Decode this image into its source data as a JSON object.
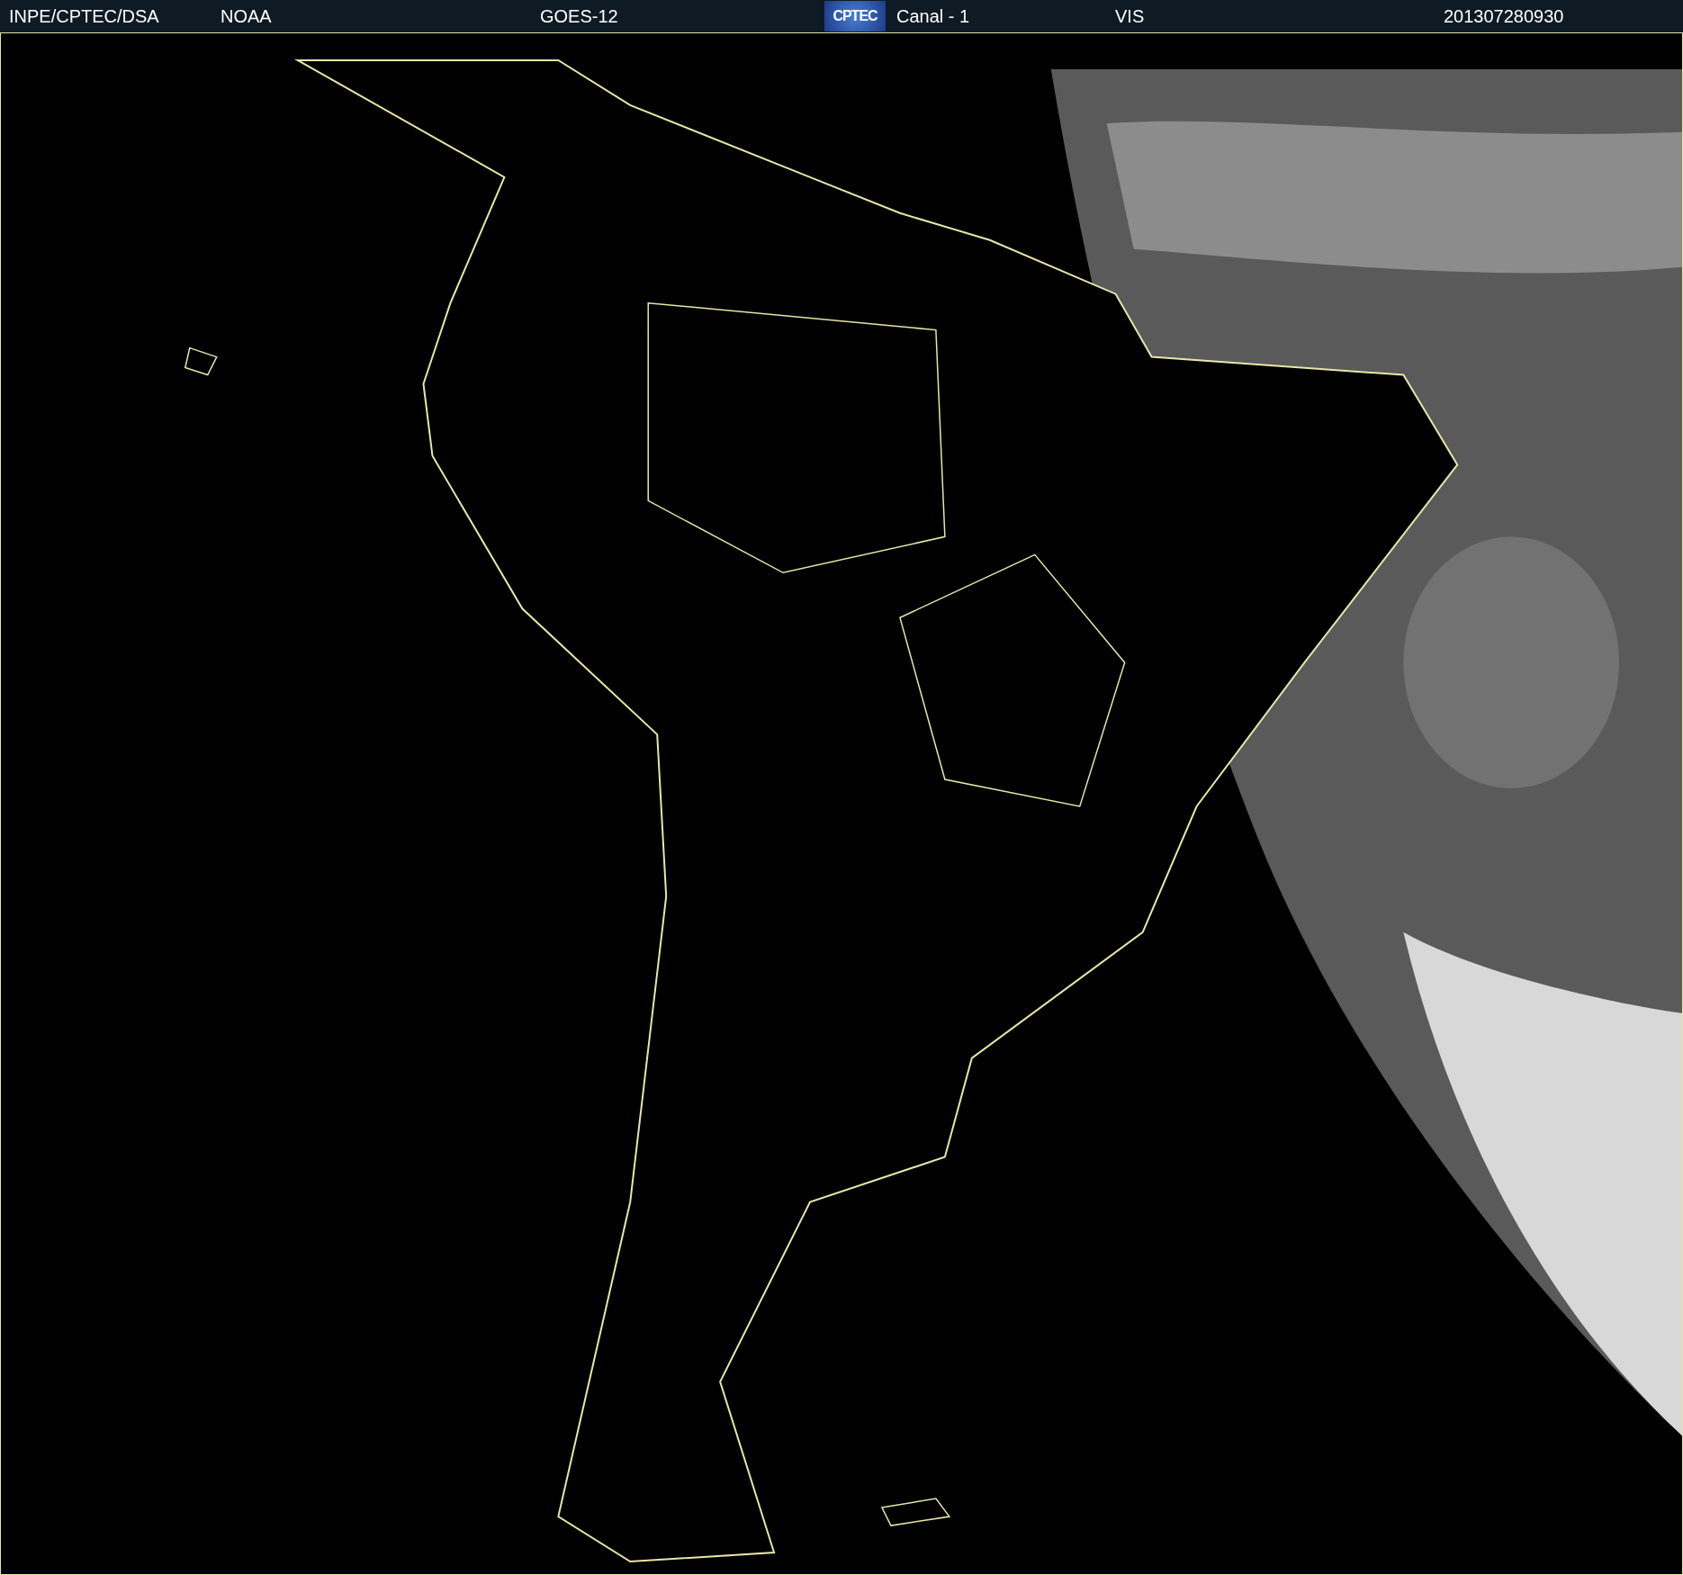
{
  "header": {
    "source": "INPE/CPTEC/DSA",
    "agency": "NOAA",
    "satellite": "GOES-12",
    "logo_text": "CPTEC",
    "channel": "Canal - 1",
    "band": "VIS",
    "timestamp": "201307280930"
  }
}
